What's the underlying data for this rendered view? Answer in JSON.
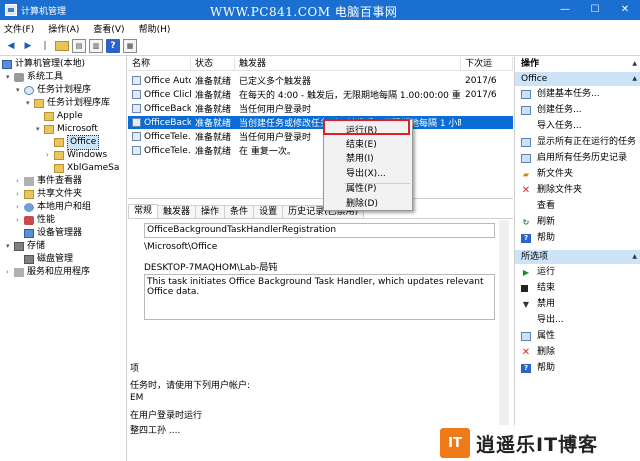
{
  "titlebar": {
    "title": "计算机管理",
    "watermark": "WWW.PC841.COM 电脑百事网",
    "minimize": "—",
    "maximize": "☐",
    "close": "✕"
  },
  "menu": [
    "文件(F)",
    "操作(A)",
    "查看(V)",
    "帮助(H)"
  ],
  "tree": {
    "root": "计算机管理(本地)",
    "system_tools": "系统工具",
    "task_scheduler": "任务计划程序",
    "task_library": "任务计划程序库",
    "apple": "Apple",
    "microsoft": "Microsoft",
    "office": "Office",
    "windows": "Windows",
    "xblgame": "XblGameSa",
    "event_viewer": "事件查看器",
    "shared_folders": "共享文件夹",
    "local_users": "本地用户和组",
    "performance": "性能",
    "device_manager": "设备管理器",
    "storage": "存储",
    "disk_mgmt": "磁盘管理",
    "services": "服务和应用程序"
  },
  "list": {
    "columns": [
      "名称",
      "状态",
      "触发器",
      "下次运"
    ],
    "rows": [
      {
        "name": "Office Auto...",
        "status": "准备就绪",
        "trigger": "已定义多个触发器",
        "next": "2017/6"
      },
      {
        "name": "Office Click...",
        "status": "准备就绪",
        "trigger": "在每天的 4:00 - 触发后，无限期地每隔 1.00:00:00 重复一次。",
        "next": "2017/6"
      },
      {
        "name": "OfficeBack...",
        "status": "准备就绪",
        "trigger": "当任何用户登录时",
        "next": ""
      },
      {
        "name": "OfficeBack...",
        "status": "准备就绪",
        "trigger": "当创建任务或修改任务时 - 触发后，无限期地每隔 1 小时 重复一次。",
        "next": ""
      },
      {
        "name": "OfficeTele...",
        "status": "准备就绪",
        "trigger": "当任何用户登录时",
        "next": ""
      },
      {
        "name": "OfficeTele...",
        "status": "准备就绪",
        "trigger": "在 重复一次。",
        "next": ""
      }
    ]
  },
  "context_menu": {
    "run": "运行(R)",
    "end": "结束(E)",
    "disable": "禁用(I)",
    "export": "导出(X)...",
    "properties": "属性(P)",
    "delete": "删除(D)"
  },
  "tabs": [
    "常规",
    "触发器",
    "操作",
    "条件",
    "设置",
    "历史记录(已禁用)"
  ],
  "detail": {
    "name": "OfficeBackgroundTaskHandlerRegistration",
    "location": "\\Microsoft\\Office",
    "author": "DESKTOP-7MAQHOM\\Lab-局钝",
    "description": "This task initiates Office Background Task Handler, which updates relevant Office data.",
    "label_options": "项",
    "label_run_as": "任务时，请使用下列用户帐户:",
    "label_account": "EM",
    "label_logged_on": "在用户登录时运行",
    "label_whether": "整四工孙 ...."
  },
  "actions": {
    "header": "操作",
    "office_section": "Office",
    "office_items": [
      "创建基本任务...",
      "创建任务...",
      "导入任务...",
      "显示所有正在运行的任务",
      "启用所有任务历史记录",
      "新文件夹",
      "删除文件夹",
      "查看",
      "刷新",
      "帮助"
    ],
    "selected_section": "所选项",
    "selected_items": [
      "运行",
      "结束",
      "禁用",
      "导出...",
      "属性",
      "删除",
      "帮助"
    ]
  },
  "logo": {
    "badge": "IT",
    "text": "逍遥乐IT博客"
  }
}
